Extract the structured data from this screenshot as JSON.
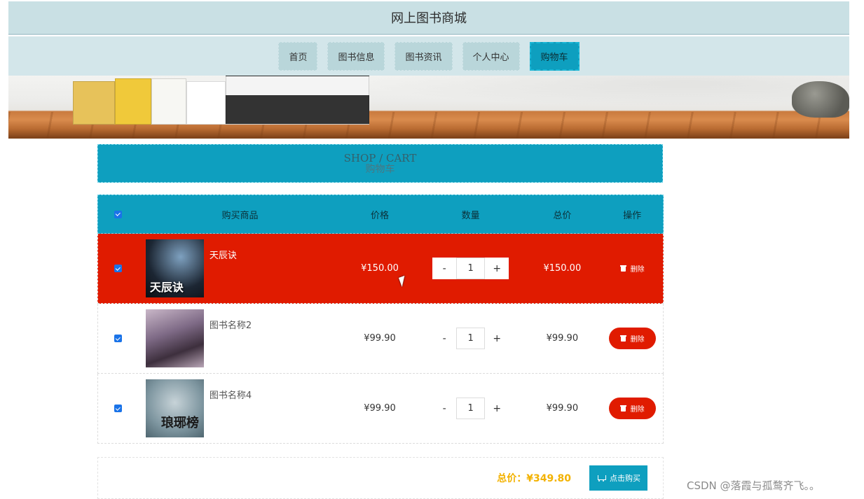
{
  "site": {
    "title": "网上图书商城"
  },
  "nav": {
    "items": [
      {
        "label": "首页",
        "active": false
      },
      {
        "label": "图书信息",
        "active": false
      },
      {
        "label": "图书资讯",
        "active": false
      },
      {
        "label": "个人中心",
        "active": false
      },
      {
        "label": "购物车",
        "active": true
      }
    ]
  },
  "cart": {
    "title_en": "SHOP / CART",
    "title_zh": "购物车",
    "headers": {
      "product": "购买商品",
      "price": "价格",
      "qty": "数量",
      "total": "总价",
      "action": "操作"
    },
    "rows": [
      {
        "name": "天辰诀",
        "cover_text": "天辰诀",
        "price": "¥150.00",
        "qty": "1",
        "total": "¥150.00",
        "delete_label": "删除",
        "checked": true,
        "highlighted": true
      },
      {
        "name": "图书名称2",
        "cover_text": "",
        "price": "¥99.90",
        "qty": "1",
        "total": "¥99.90",
        "delete_label": "删除",
        "checked": true,
        "highlighted": false
      },
      {
        "name": "图书名称4",
        "cover_text": "琅琊榜",
        "price": "¥99.90",
        "qty": "1",
        "total": "¥99.90",
        "delete_label": "删除",
        "checked": true,
        "highlighted": false
      }
    ],
    "qty_minus": "-",
    "qty_plus": "+",
    "grand_total": "总价：¥349.80",
    "buy_label": "点击购买"
  },
  "watermark": "CSDN @落霞与孤鹜齐飞。。",
  "colors": {
    "accent": "#0e9fbf",
    "danger": "#e01b00",
    "total": "#f3b200",
    "header_bg": "#c9e0e4"
  }
}
